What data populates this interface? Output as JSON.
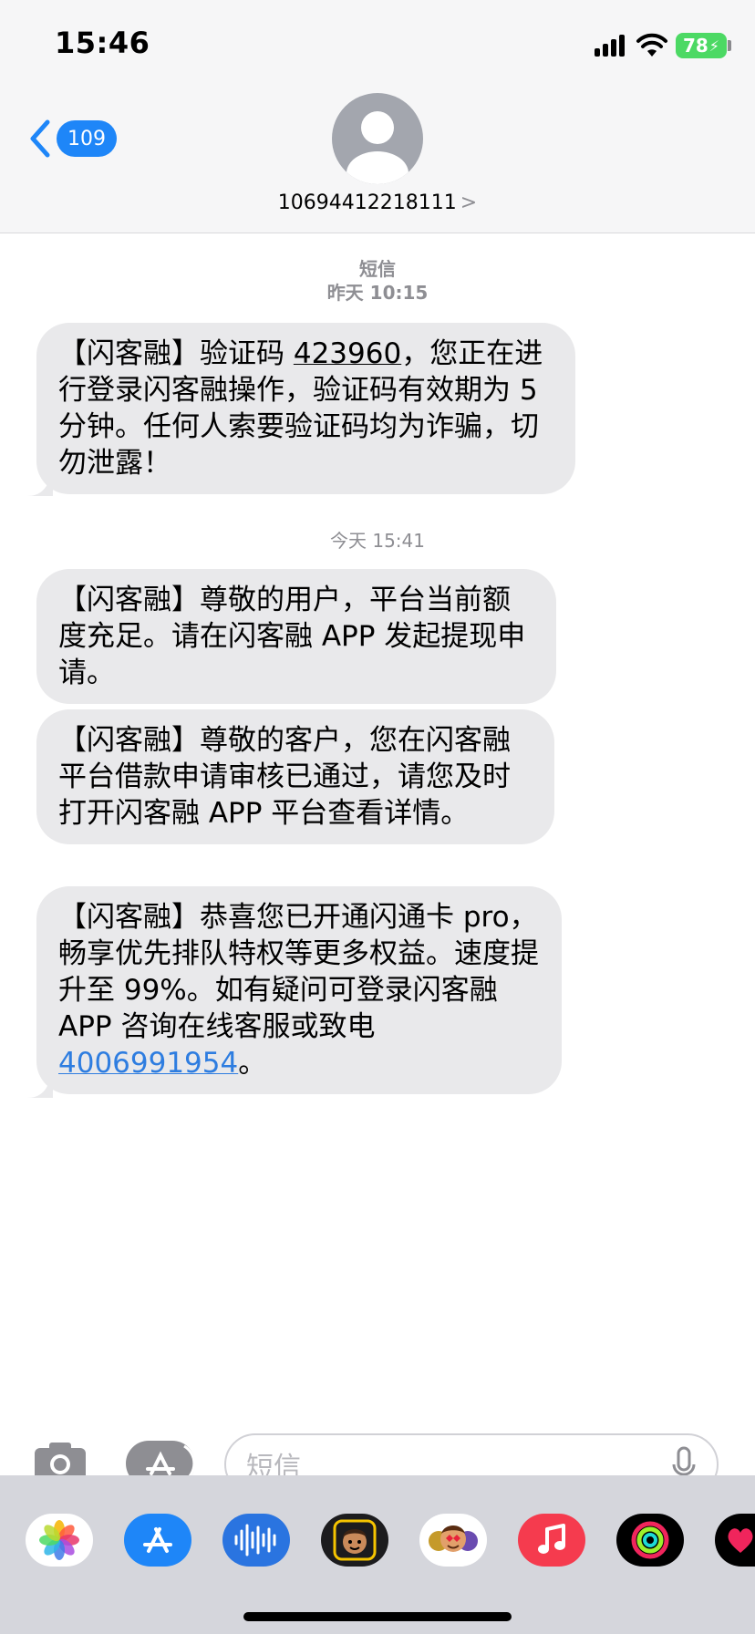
{
  "status_bar": {
    "time": "15:46",
    "battery": "78"
  },
  "header": {
    "back_count": "109",
    "sender": "10694412218111",
    "sender_chevron": ">"
  },
  "conversation": {
    "stamp1": {
      "label": "短信",
      "time": "昨天 10:15"
    },
    "stamp2": {
      "time": "今天 15:41"
    },
    "messages": [
      {
        "pre": "【闪客融】验证码 ",
        "code": "423960",
        "post": "，您正在进行登录闪客融操作，验证码有效期为 5 分钟。任何人索要验证码均为诈骗，切勿泄露！"
      },
      {
        "text": "【闪客融】尊敬的用户，平台当前额度充足。请在闪客融 APP 发起提现申请。"
      },
      {
        "text": "【闪客融】尊敬的客户，您在闪客融平台借款申请审核已通过，请您及时打开闪客融 APP 平台查看详情。"
      },
      {
        "pre": "【闪客融】恭喜您已开通闪通卡 pro，畅享优先排队特权等更多权益。速度提升至 99%。如有疑问可登录闪客融 APP 咨询在线客服或致电 ",
        "phone": "4006991954",
        "post": "。"
      }
    ]
  },
  "input": {
    "placeholder": "短信"
  },
  "app_drawer": [
    "photos-app-icon",
    "app-store-icon",
    "audio-message-icon",
    "memoji-icon",
    "animoji-stickers-icon",
    "music-app-icon",
    "activity-app-icon",
    "digital-touch-icon"
  ],
  "colors": {
    "bubble": "#e9e9eb",
    "accent": "#1e86f8",
    "link": "#2e7de0",
    "timestamp": "#8e8e93"
  }
}
